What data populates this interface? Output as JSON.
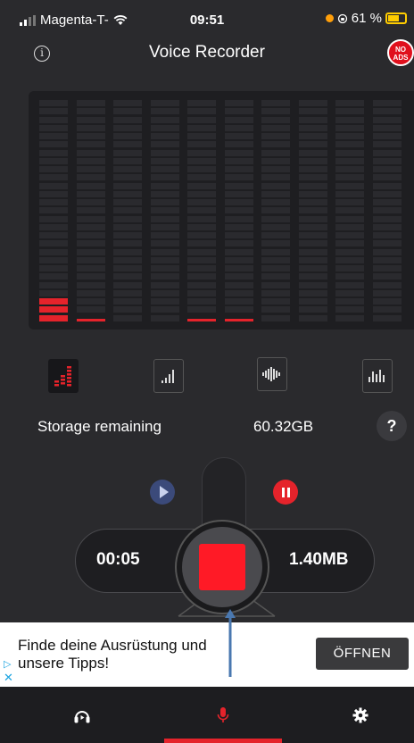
{
  "status_bar": {
    "carrier": "Magenta-T-",
    "time": "09:51",
    "battery": "61 %"
  },
  "header": {
    "title": "Voice Recorder",
    "info_icon": "info-icon",
    "no_ads_badge_line1": "NO",
    "no_ads_badge_line2": "ADS"
  },
  "meter": {
    "columns": 10,
    "rows": 27,
    "levels_lit": [
      3,
      1,
      0,
      0,
      1,
      1,
      0,
      0,
      0,
      0
    ],
    "lit_color": "#e5232b"
  },
  "modes": {
    "items": [
      {
        "name": "bar-meter-icon",
        "active": true
      },
      {
        "name": "signal-bars-icon",
        "active": false
      },
      {
        "name": "waveform-icon",
        "active": false
      },
      {
        "name": "spectrum-icon",
        "active": false
      }
    ]
  },
  "storage": {
    "label": "Storage remaining",
    "value": "60.32GB",
    "help": "?"
  },
  "recorder": {
    "elapsed": "00:05",
    "file_size": "1.40MB"
  },
  "ad": {
    "line1": "Finde deine Ausrüstung und",
    "line2": "unsere Tipps!",
    "cta": "ÖFFNEN"
  },
  "tabs": [
    {
      "name": "tab-player",
      "icon": "headphones-icon",
      "active": false
    },
    {
      "name": "tab-recorder",
      "icon": "microphone-icon",
      "active": true
    },
    {
      "name": "tab-settings",
      "icon": "gear-icon",
      "active": false
    }
  ],
  "colors": {
    "accent": "#e5232b",
    "background": "#2a2a2d"
  }
}
